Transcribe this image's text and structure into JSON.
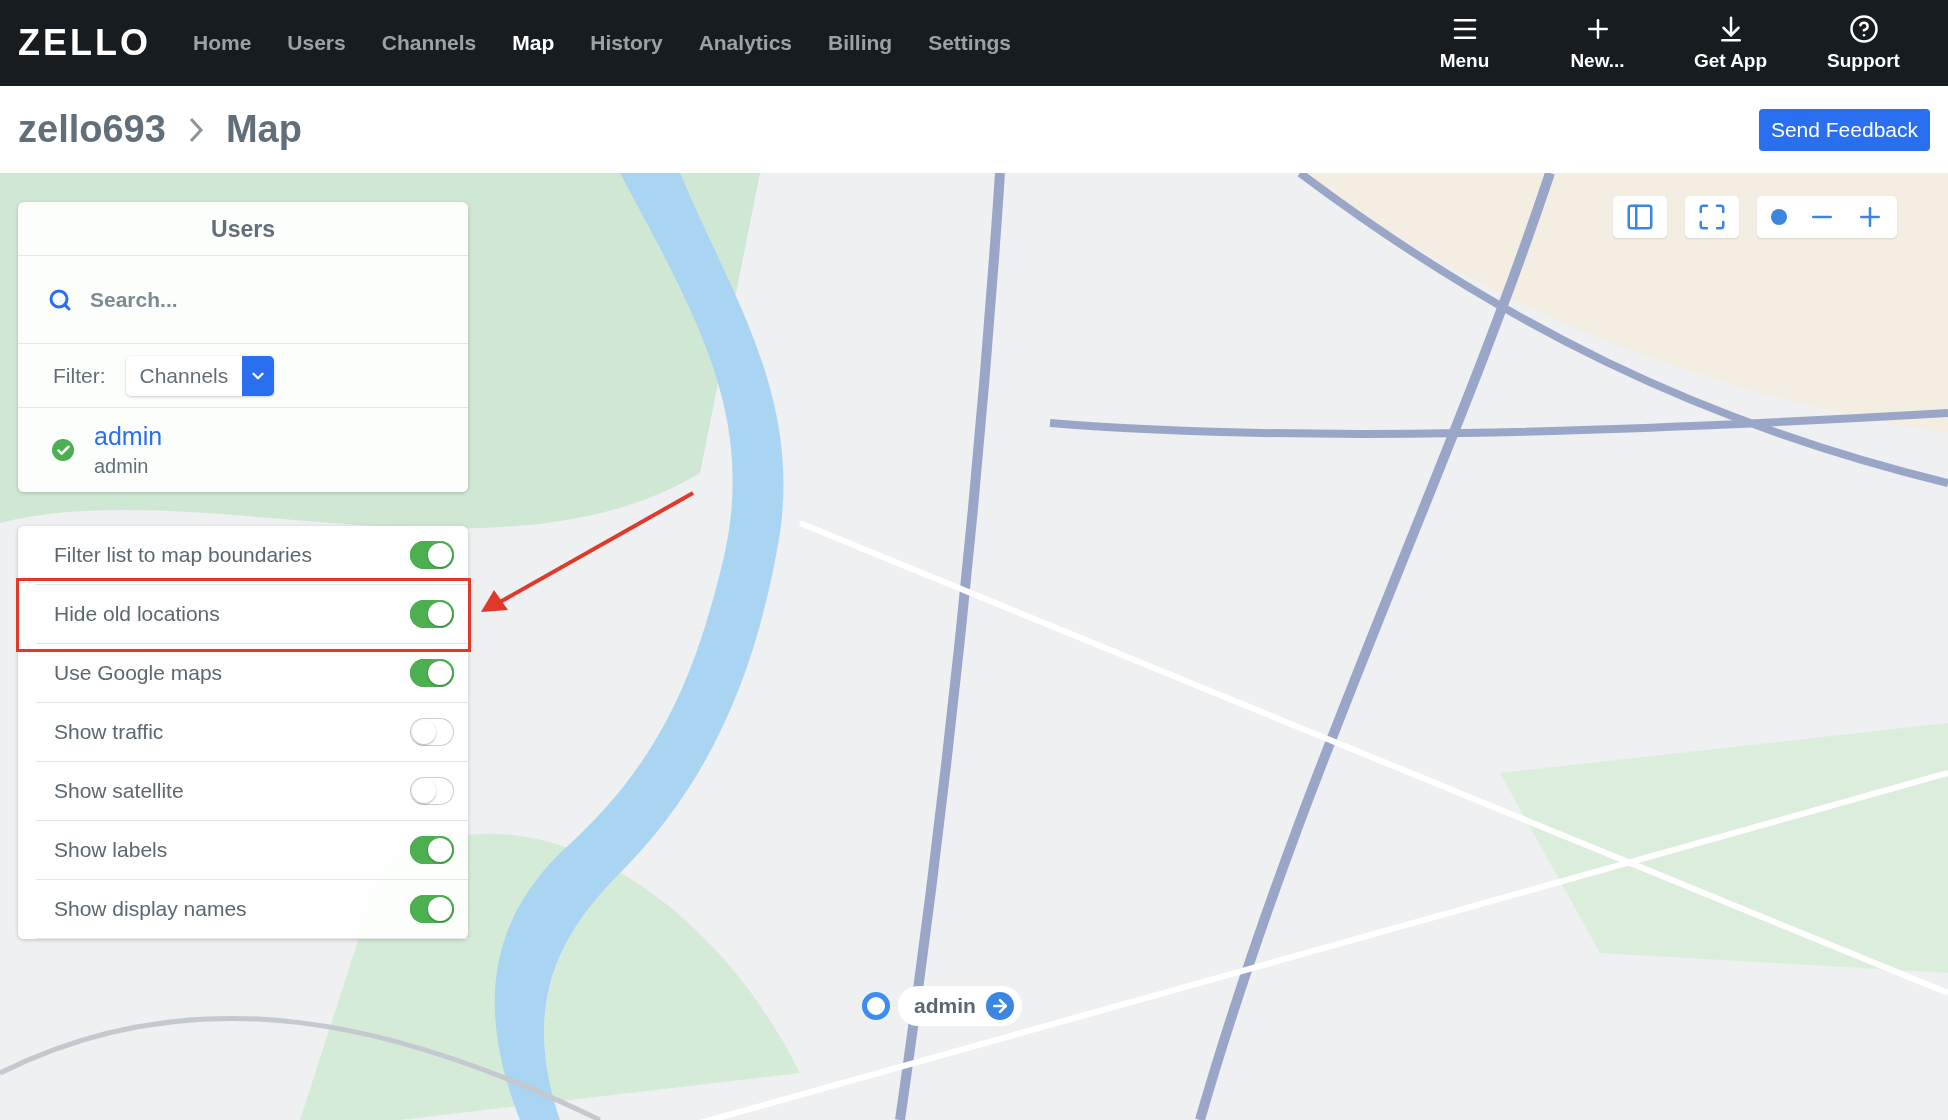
{
  "nav": {
    "logo": "ZELLO",
    "links": [
      {
        "label": "Home",
        "selected": false
      },
      {
        "label": "Users",
        "selected": false
      },
      {
        "label": "Channels",
        "selected": false
      },
      {
        "label": "Map",
        "selected": true
      },
      {
        "label": "History",
        "selected": false
      },
      {
        "label": "Analytics",
        "selected": false
      },
      {
        "label": "Billing",
        "selected": false
      },
      {
        "label": "Settings",
        "selected": false
      }
    ],
    "actions": [
      {
        "kind": "menu",
        "label": "Menu"
      },
      {
        "kind": "new",
        "label": "New..."
      },
      {
        "kind": "download",
        "label": "Get App"
      },
      {
        "kind": "help",
        "label": "Support"
      }
    ]
  },
  "breadcrumb": {
    "items": [
      "zello693",
      "Map"
    ],
    "button": "Send Feedback"
  },
  "users_panel": {
    "title": "Users",
    "search": {
      "placeholder": "Search..."
    },
    "filter": {
      "label": "Filter:",
      "value": "Channels"
    },
    "users": [
      {
        "name": "admin",
        "subtitle": "admin",
        "online": true
      }
    ]
  },
  "options": [
    {
      "label": "Filter list to map boundaries",
      "on": true,
      "highlighted": false
    },
    {
      "label": "Hide old locations",
      "on": true,
      "highlighted": true
    },
    {
      "label": "Use Google maps",
      "on": true,
      "highlighted": false
    },
    {
      "label": "Show traffic",
      "on": false,
      "highlighted": false
    },
    {
      "label": "Show satellite",
      "on": false,
      "highlighted": false
    },
    {
      "label": "Show labels",
      "on": true,
      "highlighted": false
    },
    {
      "label": "Show display names",
      "on": true,
      "highlighted": false
    }
  ],
  "map": {
    "marker": {
      "label": "admin"
    }
  }
}
